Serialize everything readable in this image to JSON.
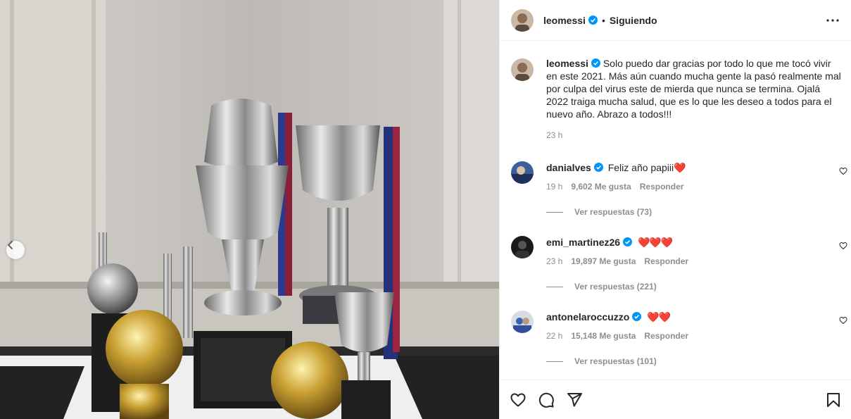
{
  "post": {
    "image_alt": "Trofeos sobre una mesa",
    "nav_prev_icon": "chevron-left-icon"
  },
  "header": {
    "username": "leomessi",
    "separator": "•",
    "follow_status": "Siguiendo",
    "more_icon": "more-horizontal-icon"
  },
  "caption": {
    "username": "leomessi",
    "text": "Solo puedo dar gracias por todo lo que me tocó vivir en este 2021. Más aún cuando mucha gente la pasó realmente mal por culpa del virus este de mierda que nunca se termina. Ojalá 2022 traiga mucha salud, que es lo que les deseo a todos para el nuevo año. Abrazo a todos!!!",
    "time": "23 h"
  },
  "comments": [
    {
      "username": "danialves",
      "text": "Feliz año papiii",
      "hearts": "❤️",
      "time": "19 h",
      "likes": "9,602 Me gusta",
      "reply_label": "Responder",
      "view_replies": "Ver respuestas (73)"
    },
    {
      "username": "emi_martinez26",
      "text": "",
      "hearts": "❤️❤️❤️",
      "time": "23 h",
      "likes": "19,897 Me gusta",
      "reply_label": "Responder",
      "view_replies": "Ver respuestas (221)"
    },
    {
      "username": "antonelaroccuzzo",
      "text": "",
      "hearts": "❤️❤️",
      "time": "22 h",
      "likes": "15,148 Me gusta",
      "reply_label": "Responder",
      "view_replies": "Ver respuestas (101)"
    }
  ],
  "actions": {
    "like_icon": "heart-icon",
    "comment_icon": "comment-icon",
    "share_icon": "send-icon",
    "save_icon": "bookmark-icon"
  },
  "colors": {
    "verified_blue": "#0095f6",
    "heart_red": "#ed4956",
    "muted_text": "#8e8e8e",
    "text": "#262626",
    "border": "#efefef"
  }
}
